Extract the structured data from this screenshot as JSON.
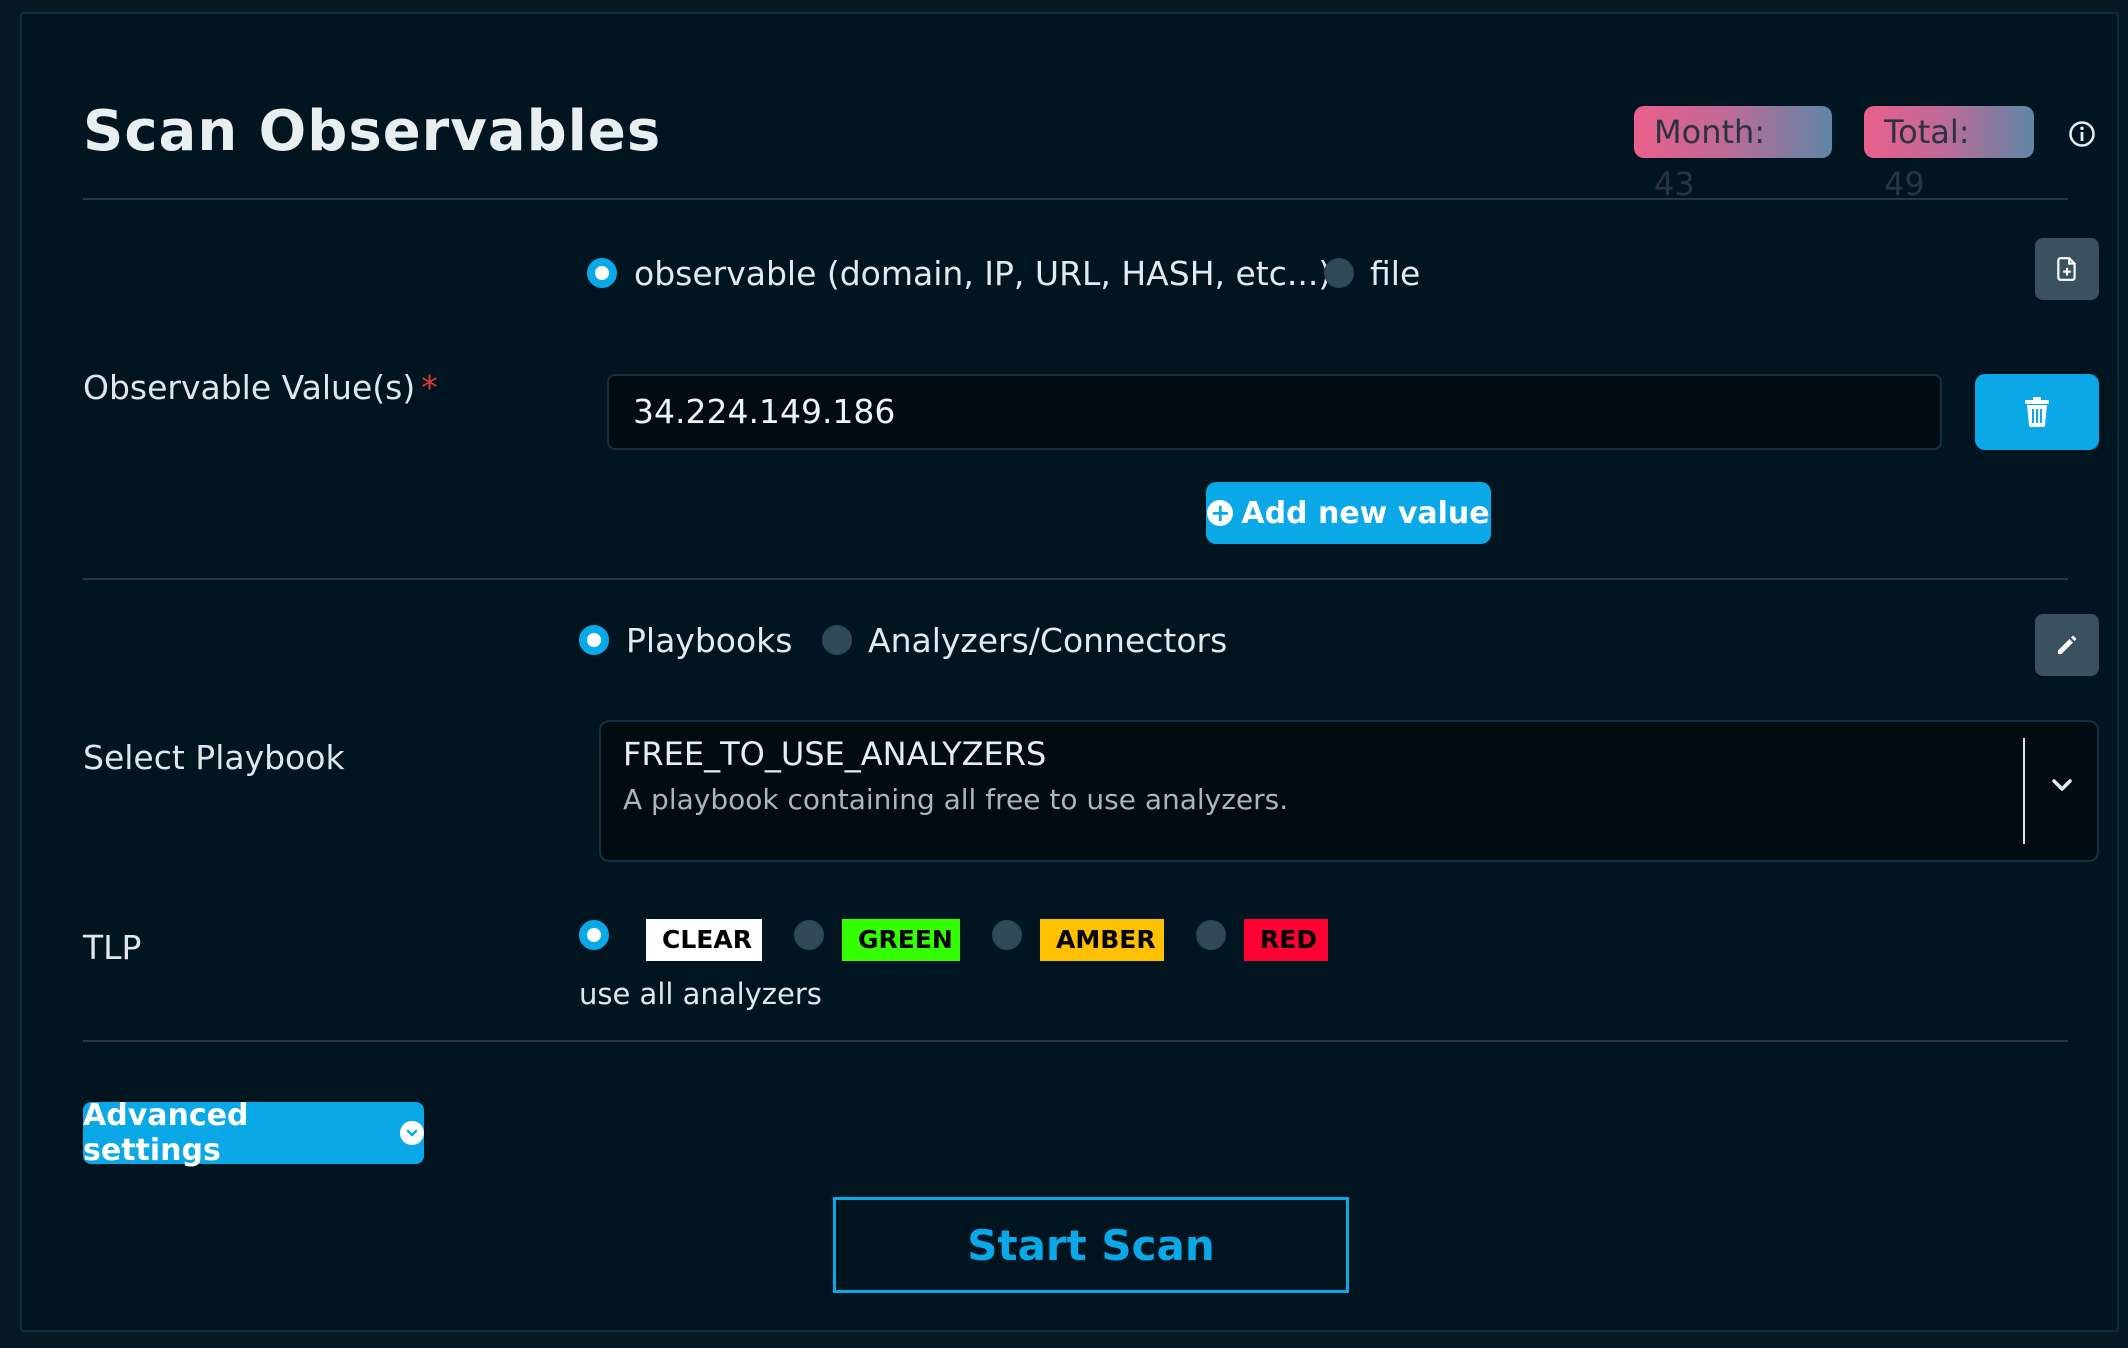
{
  "header": {
    "title": "Scan Observables",
    "badge_month": "Month: 43",
    "badge_total": "Total: 49",
    "info_icon": "info-circle-icon"
  },
  "observable_section": {
    "label": "Observable Value(s)",
    "required_mark": "*",
    "radio_observable": "observable (domain, IP, URL, HASH, etc...)",
    "radio_file": "file",
    "selected_type": "observable",
    "value": "34.224.149.186",
    "add_button": "Add new value",
    "file_icon": "file-plus-icon",
    "trash_icon": "trash-icon"
  },
  "playbook_section": {
    "label": "Select Playbook",
    "radio_playbooks": "Playbooks",
    "radio_analyzers": "Analyzers/Connectors",
    "selected_mode": "Playbooks",
    "selected_playbook": "FREE_TO_USE_ANALYZERS",
    "playbook_description": "A playbook containing all free to use analyzers.",
    "edit_icon": "pencil-icon"
  },
  "tlp_section": {
    "label": "TLP",
    "options": [
      {
        "label": "CLEAR",
        "color": "#ffffff"
      },
      {
        "label": "GREEN",
        "color": "#33ff00"
      },
      {
        "label": "AMBER",
        "color": "#ffc000"
      },
      {
        "label": "RED",
        "color": "#ff0033"
      }
    ],
    "selected": "CLEAR",
    "hint": "use all analyzers"
  },
  "advanced_button": "Advanced settings",
  "start_button": "Start Scan",
  "colors": {
    "accent": "#0aa8e6",
    "background": "#011520"
  }
}
